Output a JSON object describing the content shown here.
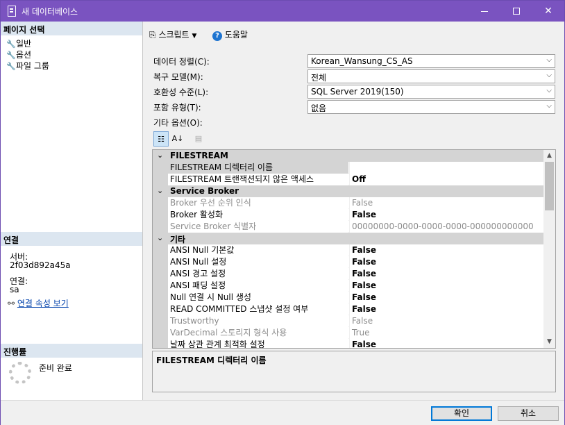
{
  "window": {
    "title": "새 데이터베이스"
  },
  "left_panel": {
    "page_select_header": "페이지 선택",
    "pages": [
      "일반",
      "옵션",
      "파일 그룹"
    ],
    "connection_header": "연결",
    "server_label": "서버:",
    "server_value": "2f03d892a45a",
    "connection_label": "연결:",
    "connection_value": "sa",
    "view_connection_link": "연결 속성 보기",
    "progress_header": "진행률",
    "progress_status": "준비 완료"
  },
  "toolbar": {
    "script_label": "스크립트",
    "help_label": "도움말"
  },
  "form": {
    "collation_label": "데이터 정렬(C):",
    "collation_value": "Korean_Wansung_CS_AS",
    "recovery_label": "복구 모델(M):",
    "recovery_value": "전체",
    "compat_label": "호환성 수준(L):",
    "compat_value": "SQL Server 2019(150)",
    "containment_label": "포함 유형(T):",
    "containment_value": "없음",
    "other_options_label": "기타 옵션(O):"
  },
  "grid": {
    "cat_filestream": "FILESTREAM",
    "fs_dir_name": "FILESTREAM 디렉터리 이름",
    "fs_dir_value": "",
    "fs_access_name": "FILESTREAM 트랜잭션되지 않은 액세스",
    "fs_access_value": "Off",
    "cat_broker": "Service Broker",
    "broker_priority_name": "Broker 우선 순위 인식",
    "broker_priority_value": "False",
    "broker_enabled_name": "Broker 활성화",
    "broker_enabled_value": "False",
    "broker_id_name": "Service Broker 식별자",
    "broker_id_value": "00000000-0000-0000-0000-000000000000",
    "cat_misc": "기타",
    "ansi_null_default_name": "ANSI Null 기본값",
    "ansi_null_default_value": "False",
    "ansi_nulls_name": "ANSI Null 설정",
    "ansi_nulls_value": "False",
    "ansi_warnings_name": "ANSI 경고 설정",
    "ansi_warnings_value": "False",
    "ansi_padding_name": "ANSI 패딩 설정",
    "ansi_padding_value": "False",
    "concat_null_name": "Null 연결 시 Null 생성",
    "concat_null_value": "False",
    "rcsi_name": "READ COMMITTED 스냅샷 설정 여부",
    "rcsi_value": "False",
    "trustworthy_name": "Trustworthy",
    "trustworthy_value": "False",
    "vardecimal_name": "VarDecimal 스토리지 형식 사용",
    "vardecimal_value": "True",
    "date_corr_name": "날짜 상관 관계 최적화 설정",
    "date_corr_value": "False"
  },
  "description": "FILESTREAM 디렉터리 이름",
  "footer": {
    "ok_label": "확인",
    "cancel_label": "취소"
  }
}
